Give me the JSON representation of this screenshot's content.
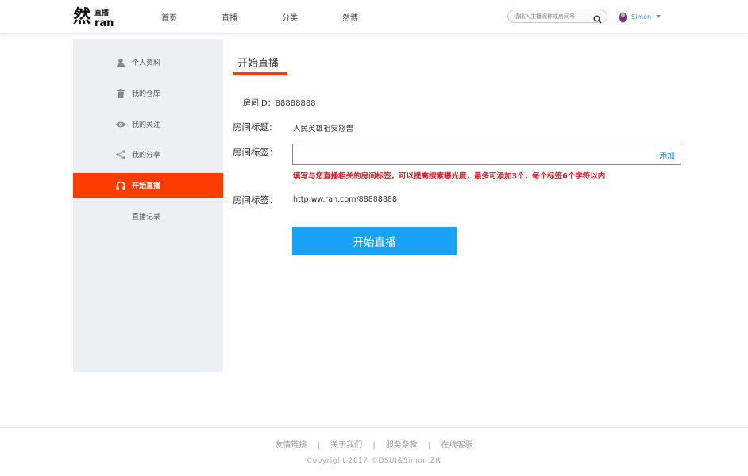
{
  "header": {
    "logo_text": "然直播 ran",
    "nav": [
      "首页",
      "直播",
      "分类",
      "然博"
    ],
    "search_placeholder": "请输入主播昵称或房间号",
    "username": "Simon"
  },
  "sidebar": {
    "items": [
      {
        "label": "个人资料",
        "icon": "user-icon"
      },
      {
        "label": "我的仓库",
        "icon": "trash-icon"
      },
      {
        "label": "我的关注",
        "icon": "eye-icon"
      },
      {
        "label": "我的分享",
        "icon": "share-icon"
      },
      {
        "label": "开始直播",
        "icon": "headphones-icon",
        "active": true
      },
      {
        "label": "直播记录",
        "icon": ""
      }
    ]
  },
  "main": {
    "title": "开始直播",
    "room_id": "房间ID：88888888",
    "room_title_label": "房间标题:",
    "room_title_value": "人民英雄祖安怒兽",
    "room_tag_label": "房间标签：",
    "add_label": "添加",
    "hint": "填写与您直播相关的房间标签，可以提高搜索曝光度，最多可添加3个，每个标签6个字符以内",
    "room_url_label": "房间标签：",
    "room_url_value": "http:ww.ran.com/88888888",
    "start_button": "开始直播"
  },
  "footer": {
    "links": [
      "友情链接",
      "关于我们",
      "服务条款",
      "在线客服"
    ],
    "separator": "|",
    "copyright": "Copyright 2017 ©DSUI&Simon.ZR"
  },
  "colors": {
    "accent": "#ff3c00",
    "button": "#17a1f7",
    "link": "#1a8ee8",
    "hint": "#e8141f"
  }
}
